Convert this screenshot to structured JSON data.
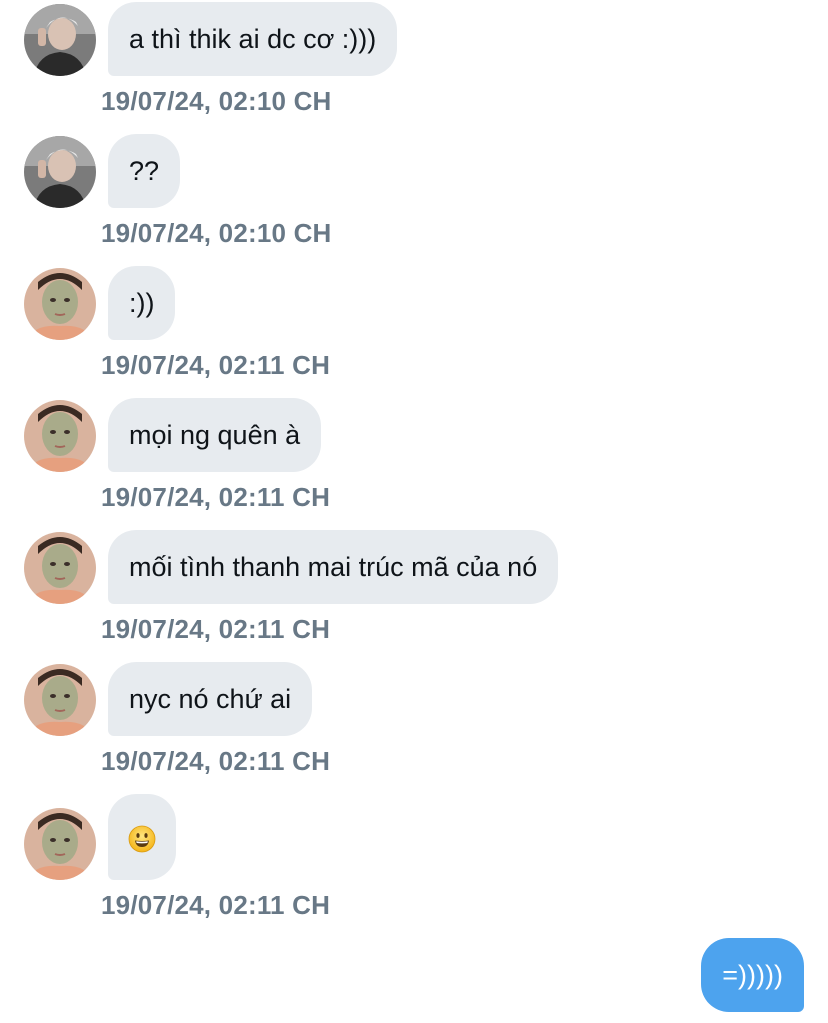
{
  "conversation": {
    "messages": [
      {
        "sender": "boy",
        "text": "a thì thik ai dc cơ :)))",
        "time": "19/07/24, 02:10 CH"
      },
      {
        "sender": "boy",
        "text": "??",
        "time": "19/07/24, 02:10 CH"
      },
      {
        "sender": "girl",
        "text": ":))",
        "time": "19/07/24, 02:11 CH"
      },
      {
        "sender": "girl",
        "text": "mọi ng quên à",
        "time": "19/07/24, 02:11 CH"
      },
      {
        "sender": "girl",
        "text": "mối tình thanh mai trúc mã của nó",
        "time": "19/07/24, 02:11 CH"
      },
      {
        "sender": "girl",
        "text": "nyc nó chứ ai",
        "time": "19/07/24, 02:11 CH"
      },
      {
        "sender": "girl",
        "text": "",
        "emoji": "grinning-face-emoji",
        "time": "19/07/24, 02:11 CH"
      }
    ],
    "outgoing": {
      "text": "=)))))"
    }
  },
  "colors": {
    "incoming_bubble": "#e7ebef",
    "outgoing_bubble": "#4da3ee",
    "timestamp": "#687886",
    "message_text": "#0f1419"
  }
}
